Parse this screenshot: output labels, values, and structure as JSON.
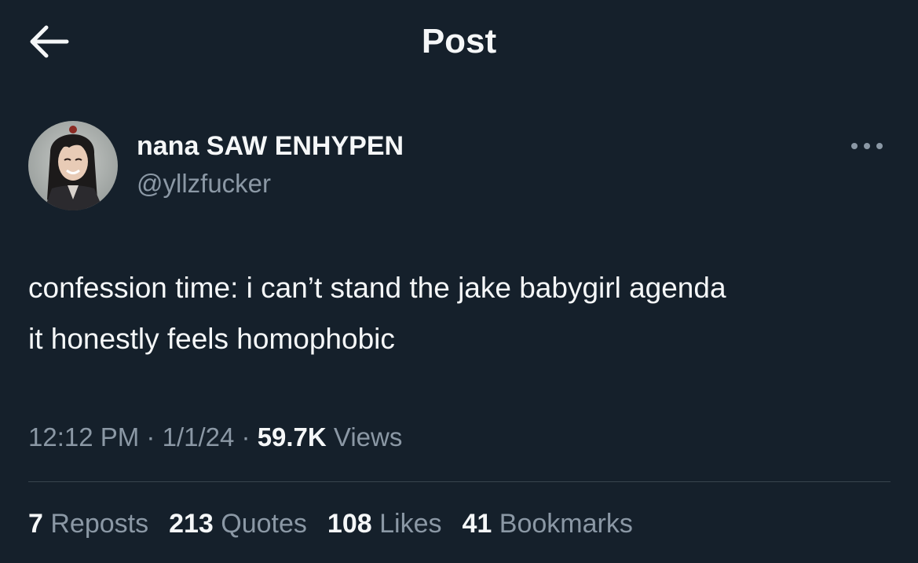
{
  "header": {
    "title": "Post",
    "back_icon": "arrow-left-icon"
  },
  "author": {
    "display_name": "nana SAW ENHYPEN",
    "handle": "@yllzfucker",
    "more_icon": "more-horizontal-icon"
  },
  "tweet": {
    "lines": [
      "confession time: i can’t stand the jake babygirl agenda",
      "it honestly feels homophobic"
    ]
  },
  "meta": {
    "time": "12:12 PM",
    "separator": "·",
    "date": "1/1/24",
    "views_count": "59.7K",
    "views_label": "Views"
  },
  "stats": [
    {
      "count": "7",
      "label": "Reposts"
    },
    {
      "count": "213",
      "label": "Quotes"
    },
    {
      "count": "108",
      "label": "Likes"
    },
    {
      "count": "41",
      "label": "Bookmarks"
    }
  ],
  "colors": {
    "background": "#15202b",
    "primary_text": "#f5f7f8",
    "secondary_text": "#8b98a5",
    "divider": "#38444d"
  }
}
